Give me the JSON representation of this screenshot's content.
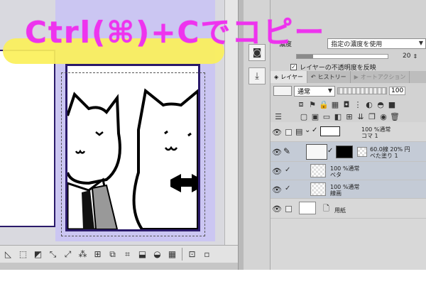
{
  "overlay": {
    "title": "Ctrl(⌘)+Cでコピー"
  },
  "properties": {
    "density_label": "濃度",
    "density_mode": "指定の濃度を使用",
    "density_value": "20",
    "layer_opacity_checkbox": "レイヤーの不透明度を反映"
  },
  "tabs": {
    "layer": "レイヤー",
    "history": "ヒストリー",
    "auto_action": "オートアクション"
  },
  "blend": {
    "mode": "通常",
    "opacity": "100"
  },
  "layers": [
    {
      "line1": "100 %通常",
      "line2": "コマ 1"
    },
    {
      "line1": "60.0線 20% 円",
      "line2": "ベた塗り 1"
    },
    {
      "line1": "100 %通常",
      "line2": "ベタ"
    },
    {
      "line1": "100 %通常",
      "line2": "線画"
    },
    {
      "line1": "用紙",
      "line2": ""
    }
  ],
  "colors": {
    "accent_pink": "#ee33ee",
    "highlight_yellow": "#fbf05a",
    "frame_border": "#2a1a6a",
    "canvas_lavender": "#cbc6f2",
    "selected_layer": "#c4cbd6"
  }
}
